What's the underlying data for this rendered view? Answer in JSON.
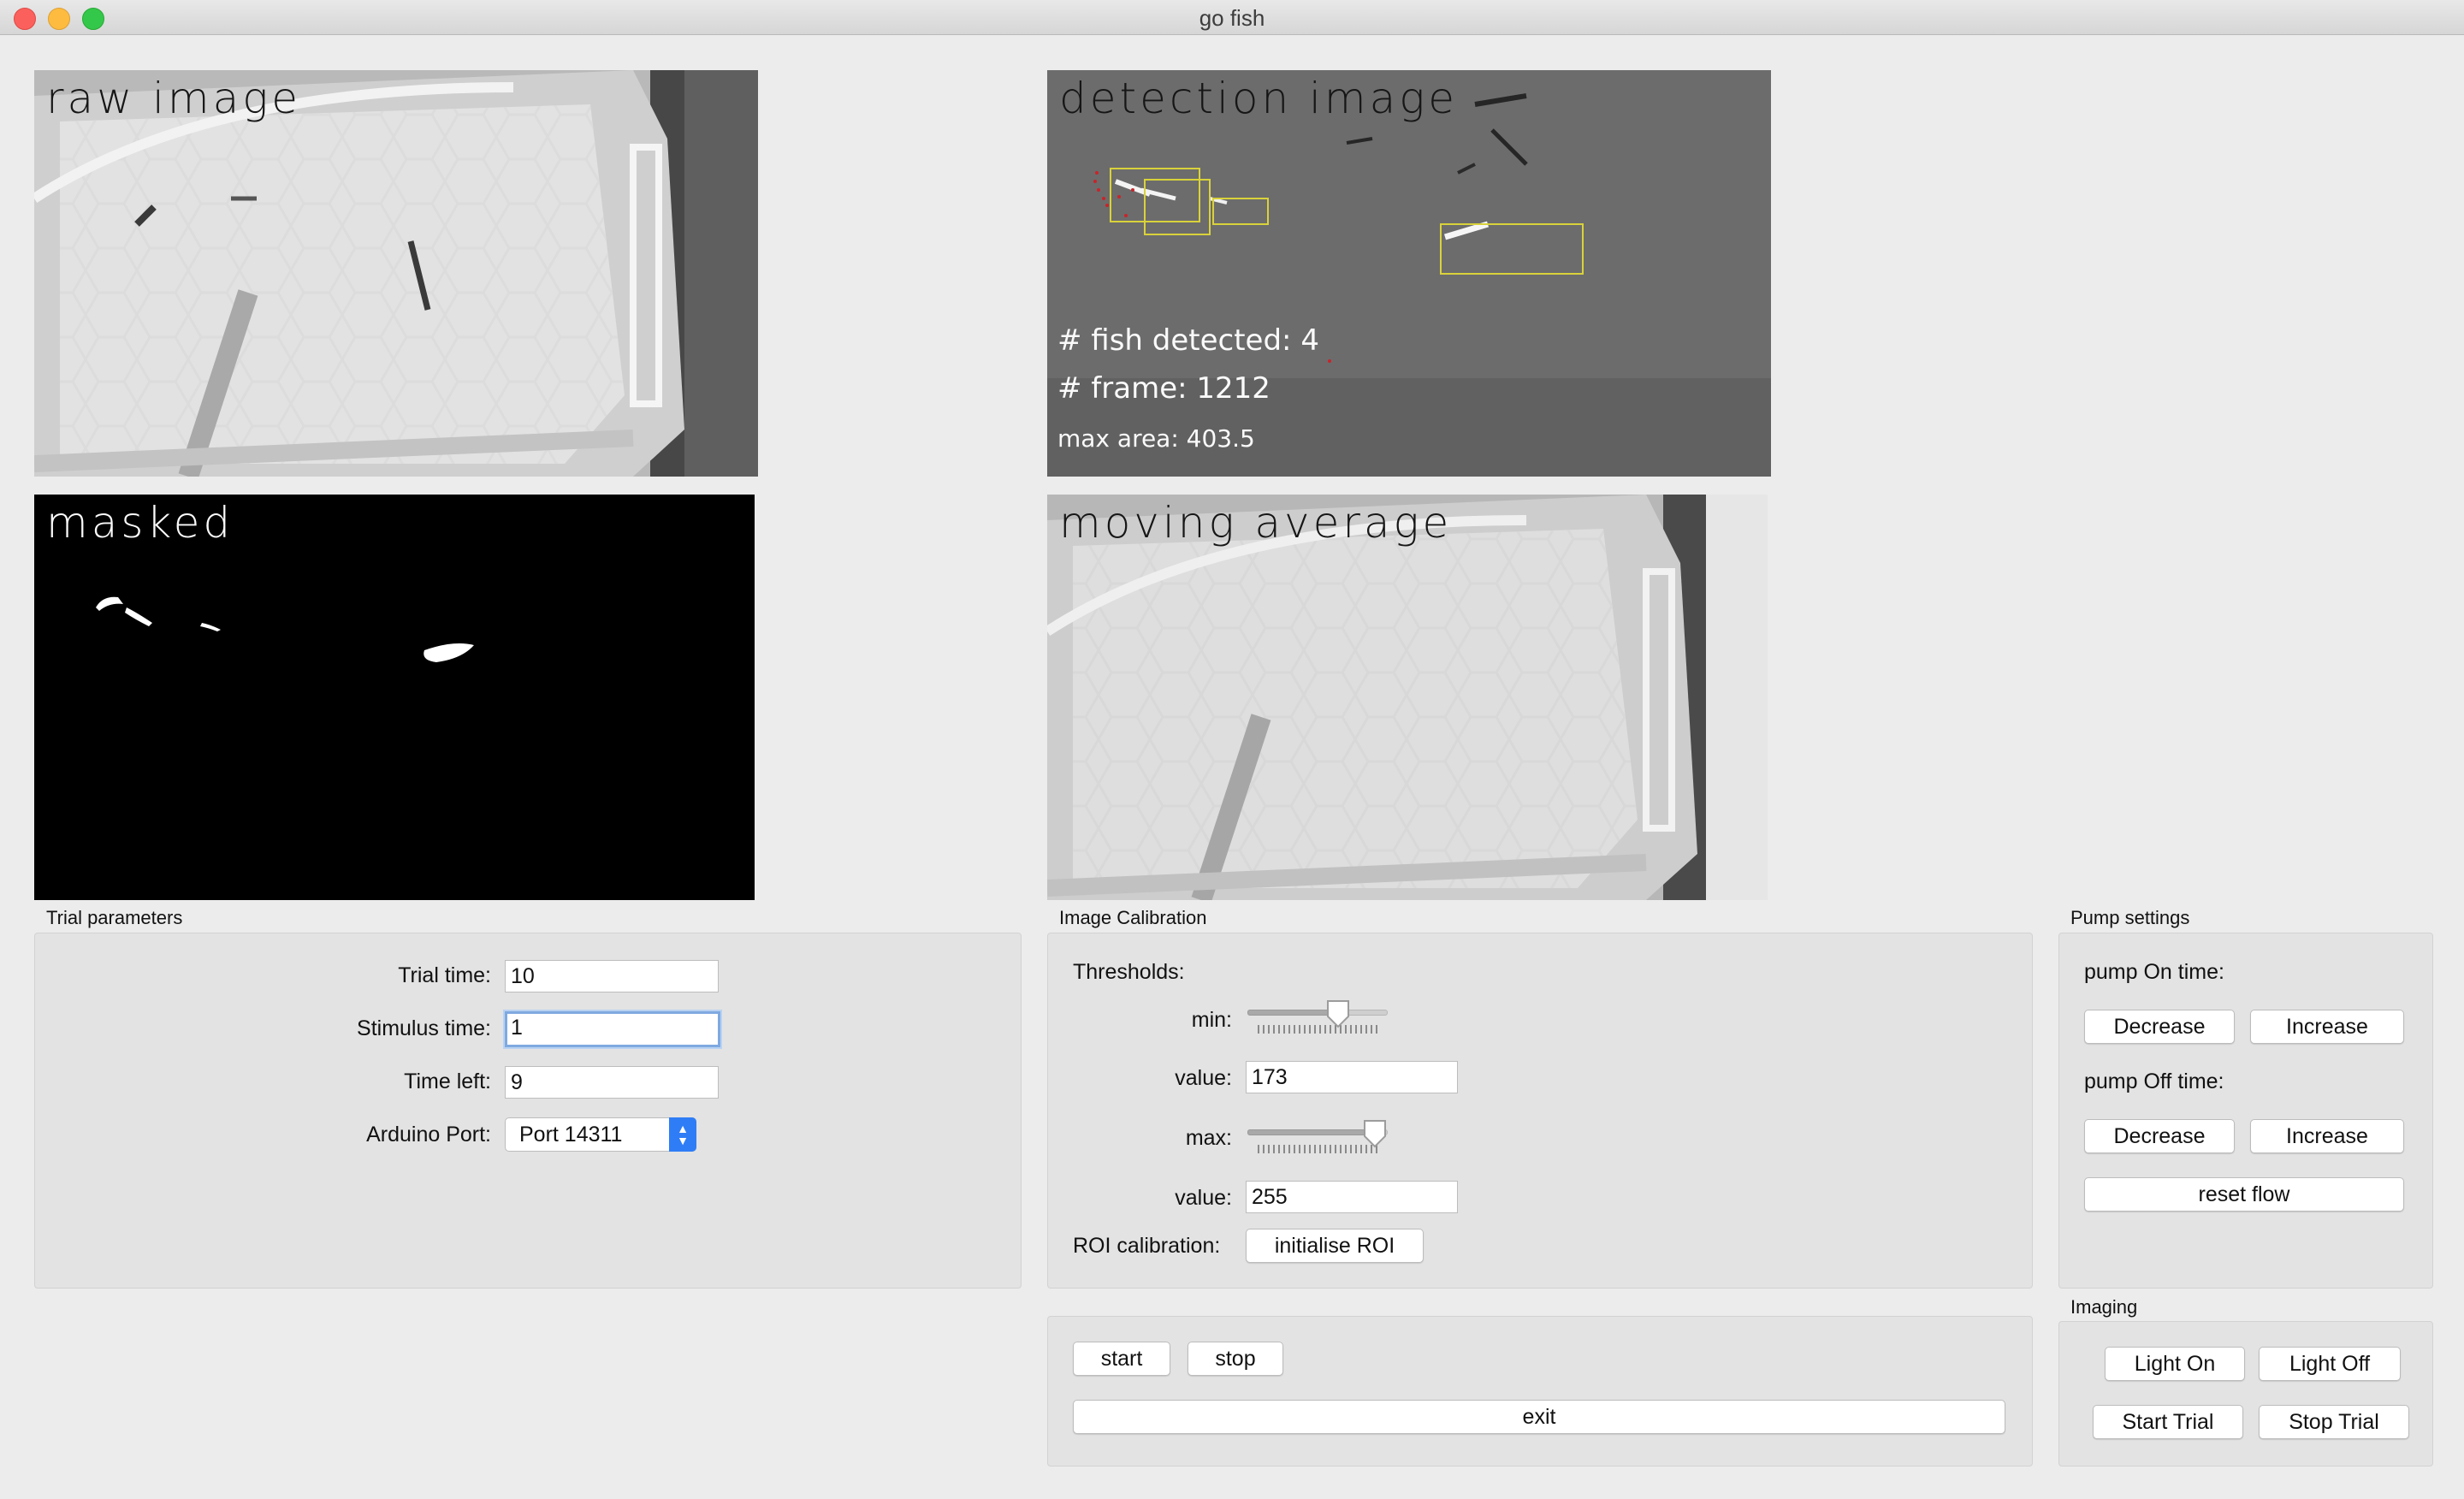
{
  "window": {
    "title": "go fish"
  },
  "panels": {
    "raw": {
      "label": "raw image"
    },
    "detection": {
      "label": "detection image",
      "fish_detected": "# fish detected: 4",
      "frame": "# frame: 1212",
      "max_area": "max area: 403.5"
    },
    "masked": {
      "label": "masked"
    },
    "moving_average": {
      "label": "moving average"
    }
  },
  "trial": {
    "title": "Trial parameters",
    "trial_time_label": "Trial time:",
    "trial_time_value": "10",
    "stimulus_time_label": "Stimulus time:",
    "stimulus_time_value": "1",
    "time_left_label": "Time left:",
    "time_left_value": "9",
    "port_label": "Arduino Port:",
    "port_value": "Port 14311"
  },
  "calibration": {
    "title": "Image Calibration",
    "thresholds_label": "Thresholds:",
    "min_label": "min:",
    "min_slider_fraction": 0.68,
    "min_value_label": "value:",
    "min_value": "173",
    "max_label": "max:",
    "max_slider_fraction": 1.0,
    "max_value_label": "value:",
    "max_value": "255",
    "roi_label": "ROI calibration:",
    "roi_button": "initialise ROI"
  },
  "controls": {
    "start": "start",
    "stop": "stop",
    "exit": "exit"
  },
  "pump": {
    "title": "Pump settings",
    "on_label": "pump On time:",
    "on_decrease": "Decrease",
    "on_increase": "Increase",
    "off_label": "pump Off time:",
    "off_decrease": "Decrease",
    "off_increase": "Increase",
    "reset": "reset flow"
  },
  "imaging": {
    "title": "Imaging",
    "light_on": "Light On",
    "light_off": "Light Off",
    "start_trial": "Start Trial",
    "stop_trial": "Stop Trial"
  },
  "colors": {
    "accent": "#2f7df6",
    "focus_ring": "#7fa9e0",
    "detection_box": "#d9d23a"
  }
}
